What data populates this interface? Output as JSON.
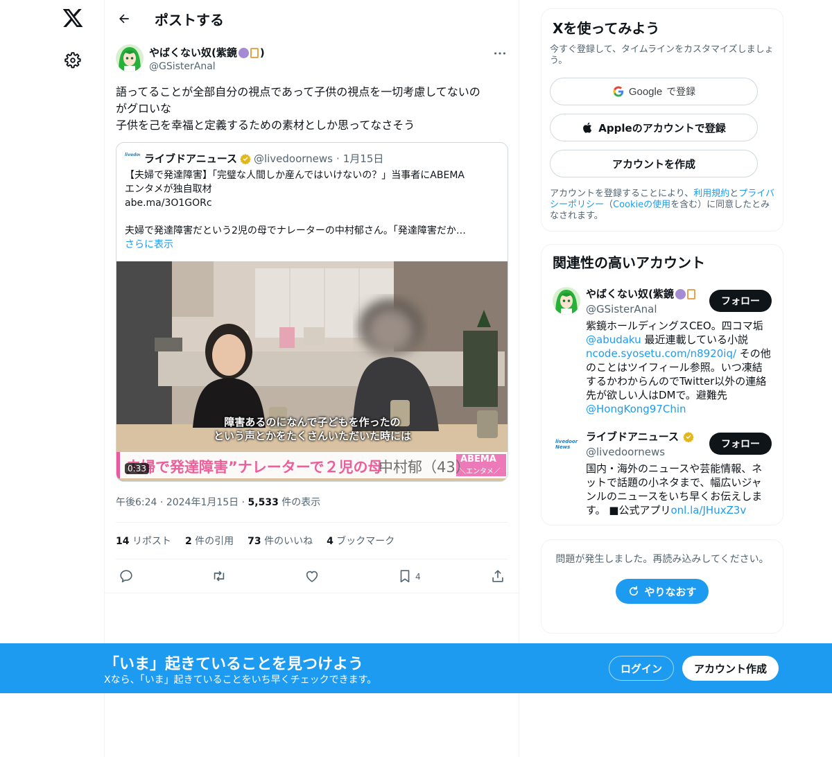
{
  "header": {
    "title": "ポストする"
  },
  "post": {
    "author_name": "やばくない奴(紫鏡",
    "author_name_suffix": ")",
    "author_handle": "@GSisterAnal",
    "text_line1": "語ってることが全部自分の視点であって子供の視点を一切考慮してないの",
    "text_line2": "がグロいな",
    "text_line3": "子供を己を幸福と定義するための素材としか思ってなさそう",
    "quote": {
      "logo_text": "livedoor News",
      "name": "ライブドアニュース",
      "handle": "@livedoornews",
      "sep": "·",
      "date": "1月15日",
      "text_line1": "【夫婦で発達障害】「完璧な人間しか産んではいけないの？」当事者にABEMA",
      "text_line2": "エンタメが独自取材",
      "text_line3": "abe.ma/3O1GORc",
      "text_line4": "夫婦で発達障害だという2児の母でナレーターの中村郁さん。「発達障害だか…",
      "show_more": "さらに表示",
      "caption_line1": "障害あるのになんで子どもを作ったの",
      "caption_line2": "という声とかをたくさんいただいた時には",
      "lower_third": "夫婦で発達障害”ナレーターで２児の母",
      "lower_name": "中村郁（43）",
      "abema_label": "ABEMA",
      "abema_sub": "＼エンタメ／",
      "duration": "0:33"
    },
    "time": "午後6:24",
    "date": "2024年1月15日",
    "dot": "·",
    "views_count": "5,533",
    "views_label": "件の表示",
    "stats": {
      "reposts_count": "14",
      "reposts_label": "リポスト",
      "quotes_count": "2",
      "quotes_label": "件の引用",
      "likes_count": "73",
      "likes_label": "件のいいね",
      "bookmarks_count": "4",
      "bookmarks_label": "ブックマーク"
    },
    "bookmark_action_count": "4"
  },
  "signup": {
    "title": "Xを使ってみよう",
    "subtitle": "今すぐ登録して、タイムラインをカスタマイズしましょう。",
    "google_brand": "Google",
    "google_label": "で登録",
    "apple_label": "Appleのアカウントで登録",
    "create_label": "アカウントを作成",
    "legal_prefix": "アカウントを登録することにより、",
    "terms": "利用規約",
    "and": "と",
    "privacy": "プライバシーポリシー",
    "paren_open": "（",
    "cookie": "Cookieの使用",
    "legal_suffix": "を含む）に同意したとみなされます。"
  },
  "related": {
    "title": "関連性の高いアカウント",
    "accounts": [
      {
        "name": "やばくない奴(紫鏡",
        "handle": "@GSisterAnal",
        "follow": "フォロー",
        "bio_1": "紫鏡ホールディングスCEO。四コマ垢",
        "bio_link1": "@abudaku",
        "bio_2": " 最近連載している小説",
        "bio_link2": "ncode.syosetu.com/n8920iq/",
        "bio_3": " その他のことはツイフィール参照。いつ凍結するかわからんのでTwitter以外の連絡先が欲しい人はDMで。避難先",
        "bio_link3": "@HongKong97Chin"
      },
      {
        "name": "ライブドアニュース",
        "handle": "@livedoornews",
        "follow": "フォロー",
        "logo_text": "livedoor News",
        "bio_1": "国内・海外のニュースや芸能情報、ネットで話題の小ネタまで、幅広いジャンルのニュースをいち早くお伝えします。 ■公式アプリ",
        "bio_link1": "onl.la/JHuxZ3v"
      }
    ]
  },
  "error": {
    "text": "問題が発生しました。再読み込みしてください。",
    "retry": "やりなおす"
  },
  "banner": {
    "title": "「いま」起きていることを見つけよう",
    "subtitle": "Xなら、「いま」起きていることをいち早くチェックできます。",
    "login": "ログイン",
    "create": "アカウント作成"
  },
  "colors": {
    "accent": "#1d9bf0",
    "text": "#0f1419",
    "secondary": "#536471",
    "border": "#eff3f4"
  }
}
